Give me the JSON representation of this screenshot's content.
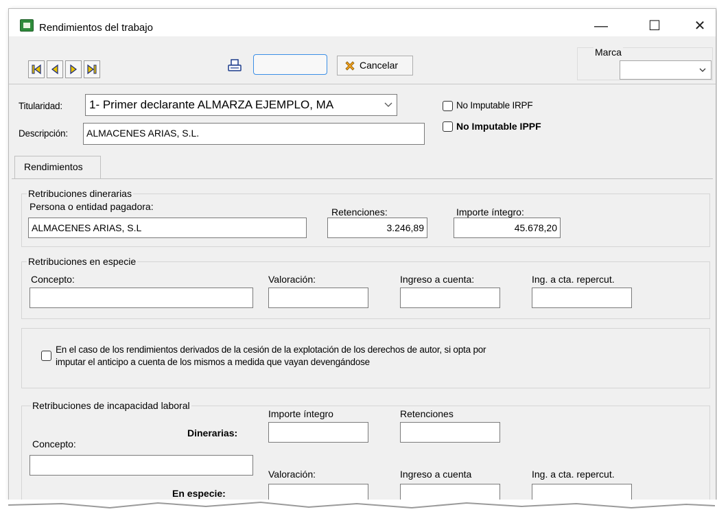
{
  "window": {
    "title": "Rendimientos del trabajo",
    "minimize": "—",
    "maximize": "☐",
    "close": "✕"
  },
  "toolbar": {
    "cancel_label": "Cancelar",
    "marca_label": "Marca",
    "marca_value": ""
  },
  "header": {
    "titularidad_label": "Titularidad:",
    "titularidad_value": "1- Primer declarante  ALMARZA EJEMPLO, MA",
    "descripcion_label": "Descripción:",
    "descripcion_value": "ALMACENES ARIAS, S.L.",
    "no_imputable_irpf": "No Imputable IRPF",
    "no_imputable_ippf": "No Imputable IPPF"
  },
  "tabs": [
    "Rendimientos"
  ],
  "dinerarias": {
    "title": "Retribuciones dinerarias",
    "pagadora_label": "Persona o entidad pagadora:",
    "pagadora_value": "ALMACENES ARIAS, S.L",
    "retenciones_label": "Retenciones:",
    "retenciones_value": "3.246,89",
    "importe_label": "Importe íntegro:",
    "importe_value": "45.678,20"
  },
  "especie": {
    "title": "Retribuciones en especie",
    "concepto_label": "Concepto:",
    "valoracion_label": "Valoración:",
    "ingreso_label": "Ingreso a cuenta:",
    "repercut_label": "Ing. a cta. repercut."
  },
  "derechos_autor": {
    "line1": "En el caso de los rendimientos derivados de la cesión de la explotación de los derechos de autor, si opta por",
    "line2": "imputar el anticipo a cuenta de los mismos a medida que vayan devengándose"
  },
  "incapacidad": {
    "title": "Retribuciones de incapacidad laboral",
    "importe_label": "Importe íntegro",
    "retenciones_label": "Retenciones",
    "dinerarias_label": "Dinerarias:",
    "concepto_label": "Concepto:",
    "valoracion_label": "Valoración:",
    "ingreso_label": "Ingreso a cuenta",
    "repercut_label": "Ing. a cta. repercut.",
    "especie_label": "En especie:"
  }
}
